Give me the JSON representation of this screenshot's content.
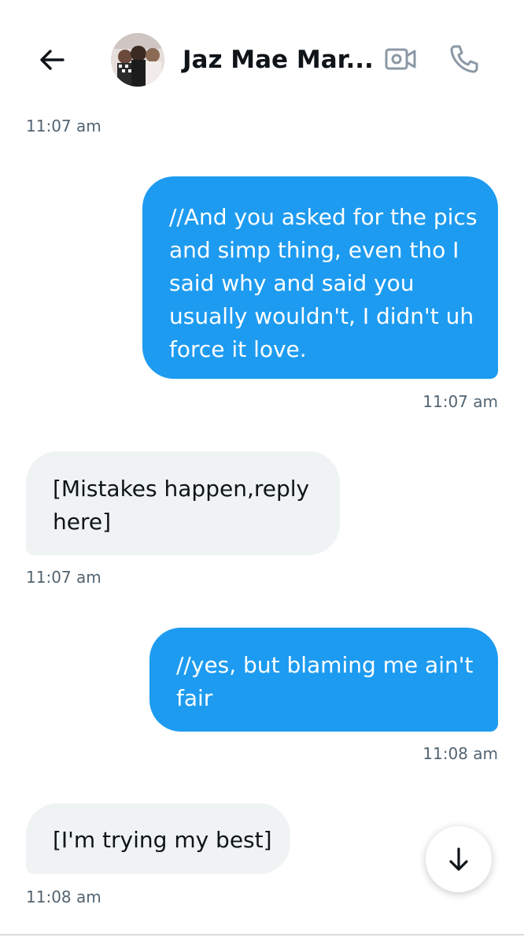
{
  "header": {
    "back_icon": "arrow-left-icon",
    "contact_name": "Jaz Mae Mar...",
    "video_icon": "video-camera-icon",
    "call_icon": "phone-icon"
  },
  "conversation": {
    "top_timestamp": "11:07 am",
    "messages": [
      {
        "direction": "sent",
        "text": "//And you asked for the pics and simp thing, even tho I said why and said you usually wouldn't, I didn't uh force it love.",
        "time": "11:07 am"
      },
      {
        "direction": "received",
        "text": "[Mistakes happen,reply here]",
        "time": "11:07 am"
      },
      {
        "direction": "sent",
        "text": "//yes, but blaming me ain't fair",
        "time": "11:08 am"
      },
      {
        "direction": "received",
        "text": "[I'm trying my best]",
        "time": "11:08 am"
      }
    ]
  },
  "scroll_button": {
    "icon": "arrow-down-icon"
  },
  "colors": {
    "sent_bubble": "#1d9bf0",
    "received_bubble": "#eff3f4",
    "timestamp": "#536471",
    "text": "#0f1419"
  }
}
